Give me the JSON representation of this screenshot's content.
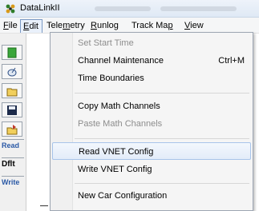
{
  "window": {
    "title": "DataLinkII"
  },
  "menubar": [
    {
      "label": "File",
      "mn": "F",
      "rest": "ile",
      "pre": ""
    },
    {
      "label": "Edit",
      "mn": "E",
      "rest": "dit",
      "pre": ""
    },
    {
      "label": "Telemetry",
      "pre": "Tele",
      "mn": "m",
      "rest": "etry"
    },
    {
      "label": "Runlog",
      "pre": "",
      "mn": "R",
      "rest": "unlog"
    },
    {
      "label": "Track Map",
      "pre": "Track Ma",
      "mn": "p",
      "rest": ""
    },
    {
      "label": "View",
      "pre": "",
      "mn": "V",
      "rest": "iew"
    }
  ],
  "toolstrip": {
    "labels": [
      "Read",
      "Dflt",
      "Write"
    ],
    "icons": [
      "new-document-icon",
      "satellite-icon",
      "open-folder-icon",
      "save-disk-icon",
      "export-folder-icon"
    ]
  },
  "edit_menu": {
    "items": [
      {
        "label": "Set Start Time",
        "shortcut": "",
        "enabled": false
      },
      {
        "label": "Channel Maintenance",
        "shortcut": "Ctrl+M",
        "enabled": true
      },
      {
        "label": "Time Boundaries",
        "shortcut": "",
        "enabled": true
      },
      {
        "label": "Copy Math Channels",
        "shortcut": "",
        "enabled": true
      },
      {
        "label": "Paste Math Channels",
        "shortcut": "",
        "enabled": false
      },
      {
        "label": "Read VNET Config",
        "shortcut": "",
        "enabled": true,
        "highlighted": true
      },
      {
        "label": "Write VNET Config",
        "shortcut": "",
        "enabled": true
      },
      {
        "label": "New Car Configuration",
        "shortcut": "",
        "enabled": true
      }
    ]
  },
  "colors": {
    "highlight_border": "#a8c4ea",
    "disabled_text": "#8d8d8d",
    "label_blue": "#2a59a6"
  }
}
